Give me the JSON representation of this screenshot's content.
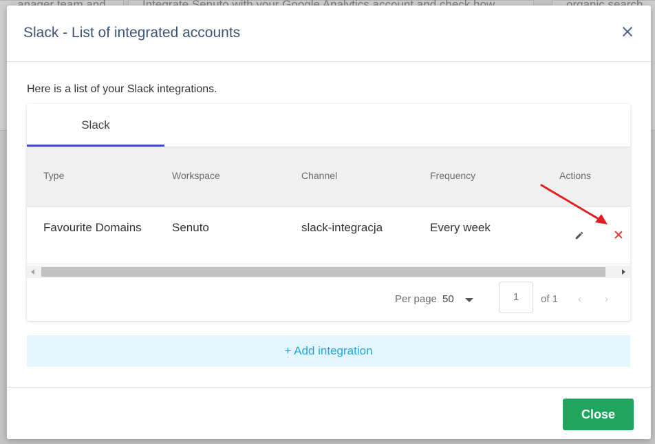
{
  "background": {
    "card1_text": "...anager team and",
    "card2_text": "Integrate Senuto with your Google Analytics account and check how",
    "card3_text": "organic search"
  },
  "modal": {
    "title": "Slack - List of integrated accounts",
    "intro": "Here is a list of your Slack integrations."
  },
  "tabs": [
    {
      "label": "Slack",
      "active": true
    }
  ],
  "table": {
    "columns": [
      "Type",
      "Workspace",
      "Channel",
      "Frequency",
      "Actions"
    ],
    "rows": [
      {
        "type": "Favourite Domains",
        "workspace": "Senuto",
        "channel": "slack-integracja",
        "frequency": "Every week"
      }
    ]
  },
  "pagination": {
    "per_page_label": "Per page",
    "per_page_value": "50",
    "page_value": "1",
    "of_label": "of 1",
    "prev_glyph": "‹",
    "next_glyph": "›"
  },
  "add_button_label": "+ Add integration",
  "close_button_label": "Close",
  "colors": {
    "title": "#3f5475",
    "tab_indicator": "#3f51b5",
    "delete_icon": "#e53935",
    "annotation_arrow": "#e02020",
    "add_button_bg": "#e3f6fd",
    "add_button_text": "#1fa8e0",
    "close_button_bg": "#21a45d"
  },
  "icons": {
    "close": "close-icon",
    "edit": "pencil-icon",
    "delete": "delete-x-icon",
    "dropdown": "caret-down-icon"
  }
}
